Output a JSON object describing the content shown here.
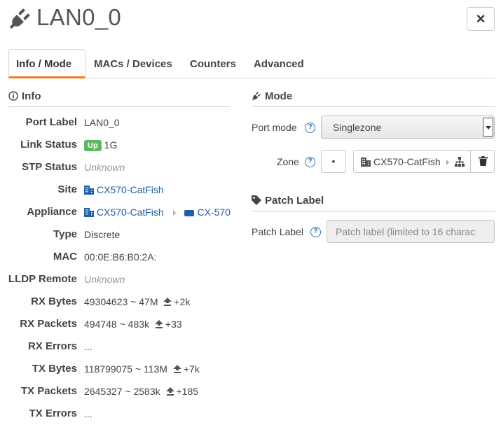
{
  "header": {
    "title": "LAN0_0",
    "close_label": "×"
  },
  "tabs": [
    {
      "label": "Info / Mode"
    },
    {
      "label": "MACs / Devices"
    },
    {
      "label": "Counters"
    },
    {
      "label": "Advanced"
    }
  ],
  "info": {
    "heading": "Info",
    "rows": {
      "port_label": {
        "label": "Port Label",
        "value": "LAN0_0"
      },
      "link_status": {
        "label": "Link Status",
        "badge": "Up",
        "value": "1G"
      },
      "stp_status": {
        "label": "STP Status",
        "value": "Unknown"
      },
      "site": {
        "label": "Site",
        "value": "CX570-CatFish"
      },
      "appliance": {
        "label": "Appliance",
        "value": "CX570-CatFish",
        "model": "CX-570"
      },
      "type": {
        "label": "Type",
        "value": "Discrete"
      },
      "mac": {
        "label": "MAC",
        "value": "00:0E:B6:B0:2A:"
      },
      "lldp_remote": {
        "label": "LLDP Remote",
        "value": "Unknown"
      },
      "rx_bytes": {
        "label": "RX Bytes",
        "value": "49304623 ~ 47M",
        "delta": "+2k"
      },
      "rx_packets": {
        "label": "RX Packets",
        "value": "494748 ~ 483k",
        "delta": "+33"
      },
      "rx_errors": {
        "label": "RX Errors",
        "value": "..."
      },
      "tx_bytes": {
        "label": "TX Bytes",
        "value": "118799075 ~ 113M",
        "delta": "+7k"
      },
      "tx_packets": {
        "label": "TX Packets",
        "value": "2645327 ~ 2583k",
        "delta": "+185"
      },
      "tx_errors": {
        "label": "TX Errors",
        "value": "..."
      }
    }
  },
  "mode": {
    "heading": "Mode",
    "port_mode_label": "Port mode",
    "port_mode_value": "Singlezone",
    "zone_label": "Zone",
    "zone_dot": "•",
    "zone_value": "CX570-CatFish"
  },
  "patch": {
    "heading": "Patch Label",
    "label": "Patch Label",
    "placeholder": "Patch label (limited to 16 charac"
  },
  "help_glyph": "?",
  "colors": {
    "accent": "#f47b20",
    "link": "#1f5ea8",
    "status_up": "#5cb85c",
    "help": "#2a6fb7"
  },
  "icons": {
    "header": "plug-icon",
    "info": "info-circle-icon",
    "mode": "plug-icon",
    "patch": "tag-icon",
    "site": "building-icon",
    "device": "device-icon",
    "upload": "upload-arrow-icon",
    "tree": "sitemap-icon",
    "delete": "trash-icon"
  }
}
